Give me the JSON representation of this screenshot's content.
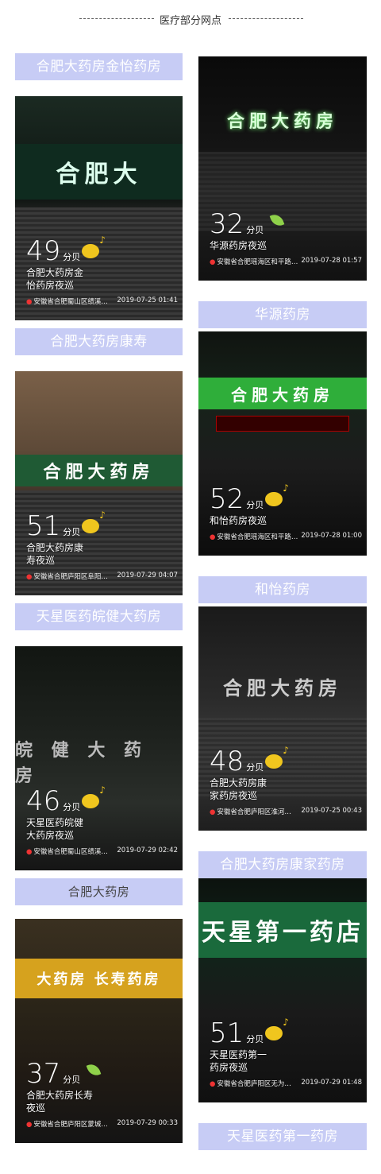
{
  "header": {
    "title": "医疗部分网点"
  },
  "left": [
    {
      "label": "合肥大药房金怡药房",
      "db": "49",
      "unit": "分贝",
      "icon": "sun",
      "desc": "合肥大药房金\n怡药房夜巡",
      "loc": "安徽省合肥蜀山区绩溪…",
      "time": "2019-07-25 01:41",
      "sign": "合肥大"
    },
    {
      "label": "合肥大药房康寿",
      "db": "51",
      "unit": "分贝",
      "icon": "sun",
      "desc": "合肥大药房康\n寿夜巡",
      "loc": "安徽省合肥庐阳区阜阳…",
      "time": "2019-07-29 04:07",
      "sign": "合肥大药房"
    },
    {
      "label": "天星医药皖健大药房",
      "db": "46",
      "unit": "分贝",
      "icon": "sun",
      "desc": "天星医药皖健\n大药房夜巡",
      "loc": "安徽省合肥蜀山区绩溪…",
      "time": "2019-07-29 02:42",
      "sign": "皖 健 大 药 房"
    },
    {
      "label": "合肥大药房",
      "db": "37",
      "unit": "分贝",
      "icon": "leaf",
      "desc": "合肥大药房长寿\n夜巡",
      "loc": "安徽省合肥庐阳区蒙城…",
      "time": "2019-07-29 00:33",
      "sign": "大药房 长寿药房"
    }
  ],
  "right": [
    {
      "label": "华源药房",
      "db": "32",
      "unit": "分贝",
      "icon": "leaf",
      "desc": "华源药房夜巡",
      "loc": "安徽省合肥瑶海区和平路…",
      "time": "2019-07-28 01:57",
      "sign": "合肥大药房"
    },
    {
      "label": "和怡药房",
      "db": "52",
      "unit": "分贝",
      "icon": "sun",
      "desc": "和怡药房夜巡",
      "loc": "安徽省合肥瑶海区和平路…",
      "time": "2019-07-28 01:00",
      "sign": "合肥大药房"
    },
    {
      "label": "合肥大药房康家药房",
      "db": "48",
      "unit": "分贝",
      "icon": "sun",
      "desc": "合肥大药房康\n家药房夜巡",
      "loc": "安徽省合肥庐阳区淮河…",
      "time": "2019-07-25 00:43",
      "sign": "合肥大药房"
    },
    {
      "label": "天星医药第一药房",
      "db": "51",
      "unit": "分贝",
      "icon": "sun",
      "desc": "天星医药第一\n药房夜巡",
      "loc": "安徽省合肥庐阳区无为…",
      "time": "2019-07-29 01:48",
      "sign": "天星第一药店"
    }
  ]
}
